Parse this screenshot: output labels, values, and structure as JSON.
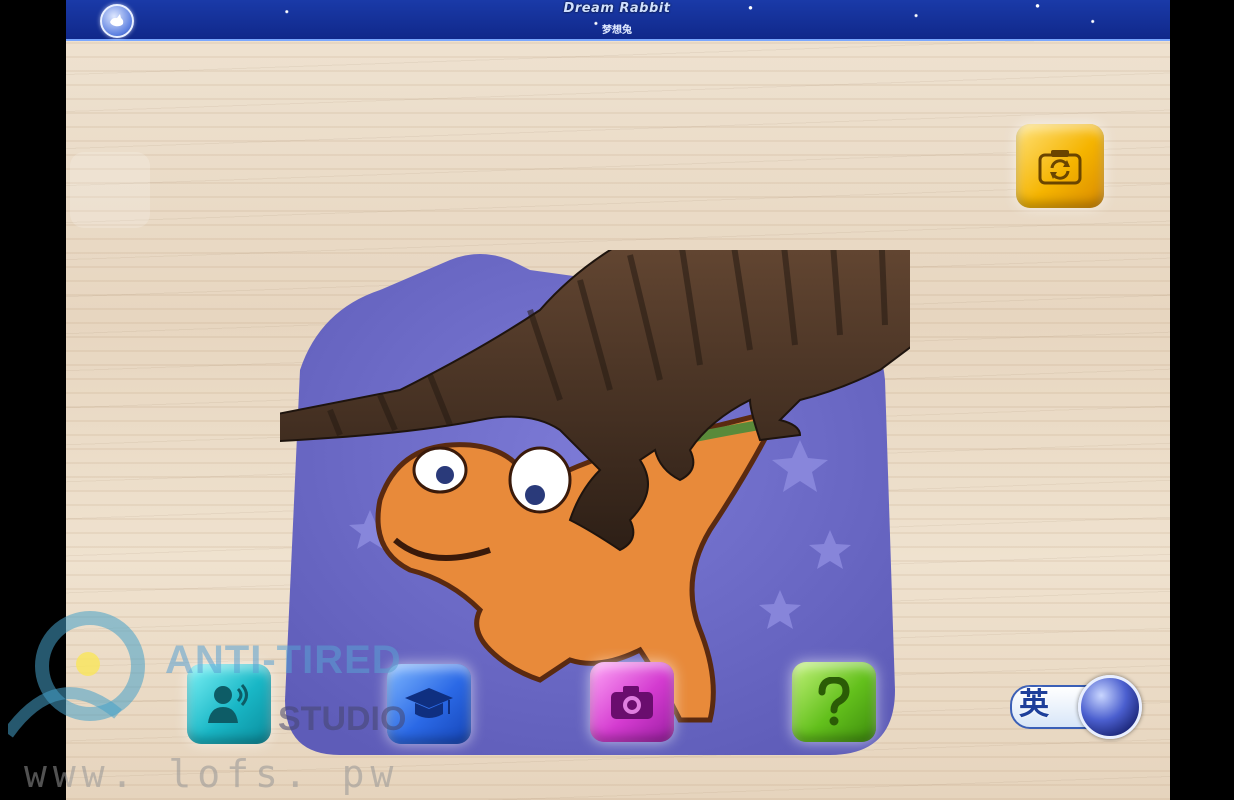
{
  "header": {
    "title": "Dream Rabbit",
    "subtitle": "梦想兔"
  },
  "icons": {
    "back": "rabbit-back-icon",
    "flip_camera": "camera-flip-icon",
    "voice": "speaking-person-icon",
    "learn": "graduation-cap-icon",
    "photo": "camera-icon",
    "help": "question-mark-icon"
  },
  "language_toggle": {
    "label": "英"
  },
  "colors": {
    "topbar": "#10288a",
    "voice": "#19b7c6",
    "learn": "#2b69e6",
    "photo": "#d43bd0",
    "help": "#63c01c",
    "flip": "#f5b400"
  },
  "watermark": {
    "brand_line1": "ANTI-TIRED",
    "brand_line2": "STUDIO",
    "url": "www. lofs. pw"
  }
}
